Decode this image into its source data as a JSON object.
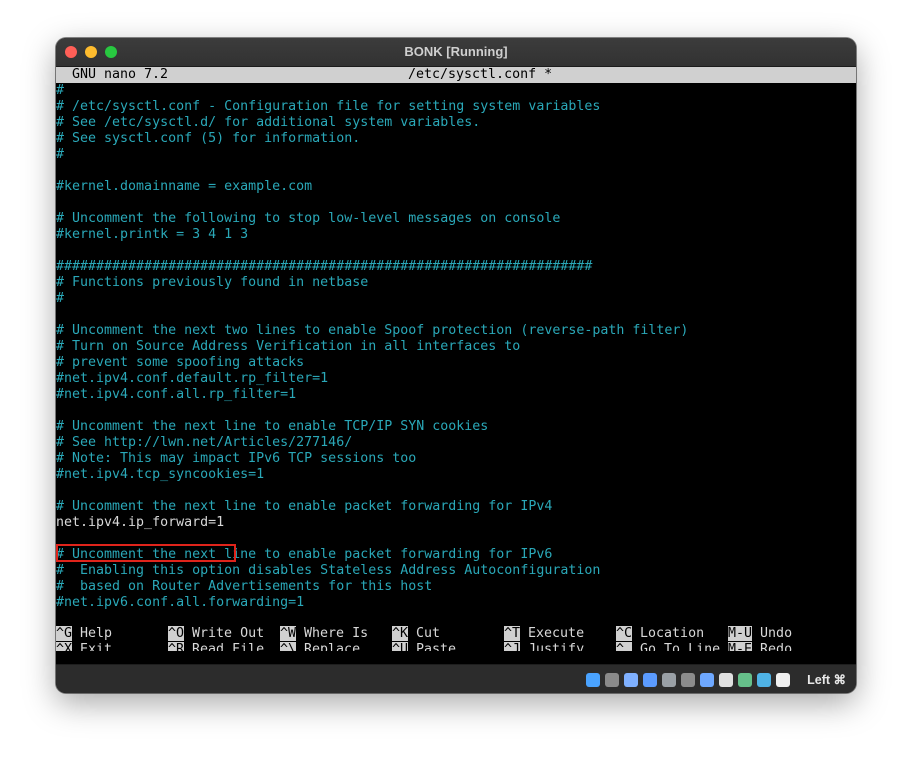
{
  "window": {
    "title": "BONK [Running]"
  },
  "nano": {
    "version": "GNU nano 7.2",
    "filename": "/etc/sysctl.conf *"
  },
  "lines": [
    "#",
    "# /etc/sysctl.conf - Configuration file for setting system variables",
    "# See /etc/sysctl.d/ for additional system variables.",
    "# See sysctl.conf (5) for information.",
    "#",
    "",
    "#kernel.domainname = example.com",
    "",
    "# Uncomment the following to stop low-level messages on console",
    "#kernel.printk = 3 4 1 3",
    "",
    "###################################################################",
    "# Functions previously found in netbase",
    "#",
    "",
    "# Uncomment the next two lines to enable Spoof protection (reverse-path filter)",
    "# Turn on Source Address Verification in all interfaces to",
    "# prevent some spoofing attacks",
    "#net.ipv4.conf.default.rp_filter=1",
    "#net.ipv4.conf.all.rp_filter=1",
    "",
    "# Uncomment the next line to enable TCP/IP SYN cookies",
    "# See http://lwn.net/Articles/277146/",
    "# Note: This may impact IPv6 TCP sessions too",
    "#net.ipv4.tcp_syncookies=1",
    "",
    "# Uncomment the next line to enable packet forwarding for IPv4",
    "net.ipv4.ip_forward=1",
    "",
    "# Uncomment the next line to enable packet forwarding for IPv6",
    "#  Enabling this option disables Stateless Address Autoconfiguration",
    "#  based on Router Advertisements for this host",
    "#net.ipv6.conf.all.forwarding=1"
  ],
  "shortcuts": [
    {
      "key": "^G",
      "label": "Help"
    },
    {
      "key": "^X",
      "label": "Exit"
    },
    {
      "key": "^O",
      "label": "Write Out"
    },
    {
      "key": "^R",
      "label": "Read File"
    },
    {
      "key": "^W",
      "label": "Where Is"
    },
    {
      "key": "^\\",
      "label": "Replace"
    },
    {
      "key": "^K",
      "label": "Cut"
    },
    {
      "key": "^U",
      "label": "Paste"
    },
    {
      "key": "^T",
      "label": "Execute"
    },
    {
      "key": "^J",
      "label": "Justify"
    },
    {
      "key": "^C",
      "label": "Location"
    },
    {
      "key": "^_",
      "label": "Go To Line"
    },
    {
      "key": "M-U",
      "label": "Undo"
    },
    {
      "key": "M-E",
      "label": "Redo"
    }
  ],
  "statusbar": {
    "icons": [
      "hard-disk-icon",
      "optical-drive-icon",
      "audio-icon",
      "network-icon",
      "usb-icon",
      "shared-folder-icon",
      "display-icon",
      "recording-icon",
      "mouse-integration-icon",
      "cpu-icon",
      "keyboard-icon"
    ],
    "host_key": "Left ⌘"
  },
  "colors": {
    "comment": "#2aa8b8",
    "text": "#d8d8d8",
    "header_bg": "#d0d0d0",
    "highlight_box": "#e0241b"
  }
}
